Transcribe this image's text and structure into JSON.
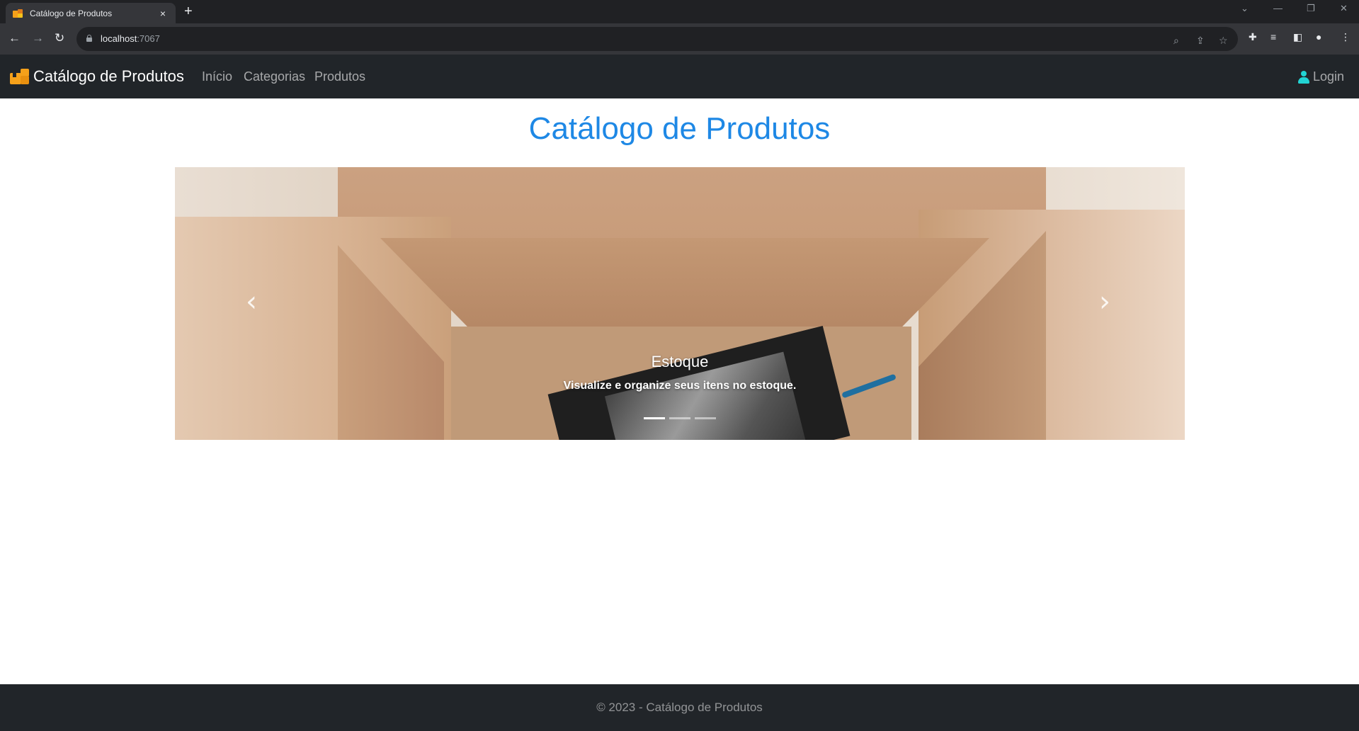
{
  "browser": {
    "tab_title": "Catálogo de Produtos",
    "tab_close": "×",
    "new_tab": "+",
    "url_host": "localhost",
    "url_port": ":7067"
  },
  "nav": {
    "brand": "Catálogo de Produtos",
    "links": [
      "Início",
      "Categorias",
      "Produtos"
    ],
    "login": "Login"
  },
  "main": {
    "title": "Catálogo de Produtos"
  },
  "carousel": {
    "caption_title": "Estoque",
    "caption_text": "Visualize e organize seus itens no estoque.",
    "prev_icon": "‹",
    "next_icon": "›",
    "slide_count": 3,
    "active_index": 0
  },
  "footer": {
    "text": "© 2023 - Catálogo de Produtos"
  },
  "colors": {
    "title_blue": "#1e88e5",
    "navbar_bg": "#212529",
    "brand_icon": "#f6a11a",
    "user_icon": "#22d3d3"
  },
  "icons": [
    "favicon-boxes-icon",
    "back-arrow-icon",
    "forward-arrow-icon",
    "reload-icon",
    "lock-icon",
    "zoom-icon",
    "share-icon",
    "star-icon",
    "extensions-icon",
    "reading-list-icon",
    "side-panel-icon",
    "profile-icon",
    "menu-icon",
    "boxes-icon",
    "user-icon",
    "chevron-left-icon",
    "chevron-right-icon"
  ]
}
